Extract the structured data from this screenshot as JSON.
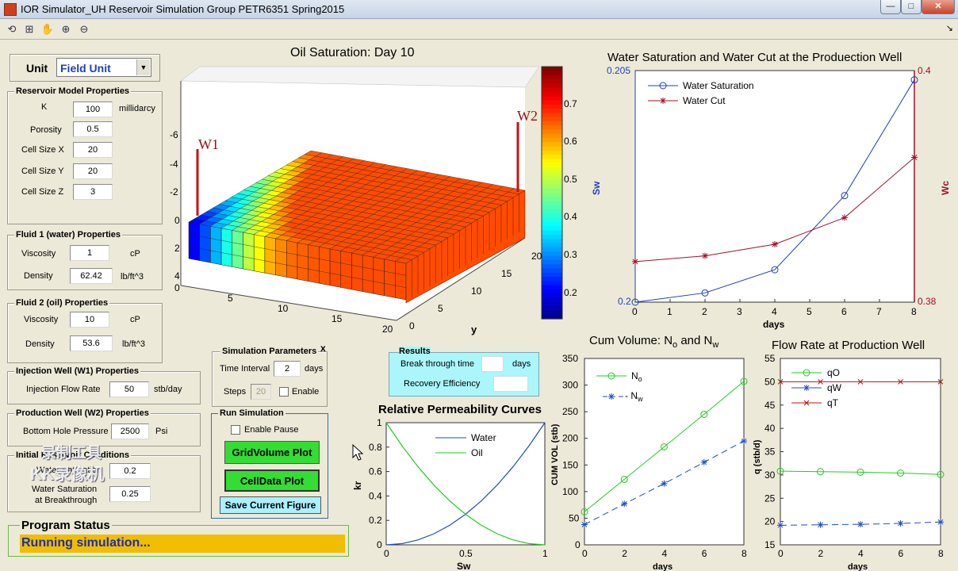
{
  "window": {
    "title": "IOR Simulator_UH Reservoir Simulation Group PETR6351 Spring2015",
    "btn_min": "—",
    "btn_max": "□",
    "btn_close": "✕",
    "dock": "↘"
  },
  "toolbar": {
    "icons": [
      "⟲",
      "⊞",
      "✋",
      "⊕",
      "⊖"
    ]
  },
  "unit": {
    "label": "Unit",
    "value": "Field Unit",
    "arrow": "▼"
  },
  "reservoir": {
    "title": "Reservoir Model Properties",
    "rows": [
      {
        "label": "K",
        "value": "100",
        "unit": "millidarcy"
      },
      {
        "label": "Porosity",
        "value": "0.5",
        "unit": ""
      },
      {
        "label": "Cell Size X",
        "value": "20",
        "unit": ""
      },
      {
        "label": "Cell Size Y",
        "value": "20",
        "unit": ""
      },
      {
        "label": "Cell Size Z",
        "value": "3",
        "unit": ""
      }
    ]
  },
  "fluid1": {
    "title": "Fluid 1 (water) Properties",
    "rows": [
      {
        "label": "Viscosity",
        "value": "1",
        "unit": "cP"
      },
      {
        "label": "Density",
        "value": "62.42",
        "unit": "lb/ft^3"
      }
    ]
  },
  "fluid2": {
    "title": "Fluid 2 (oil) Properties",
    "rows": [
      {
        "label": "Viscosity",
        "value": "10",
        "unit": "cP"
      },
      {
        "label": "Density",
        "value": "53.6",
        "unit": "lb/ft^3"
      }
    ]
  },
  "injection": {
    "title": "Injection Well (W1) Properties",
    "label": "Injection Flow Rate",
    "value": "50",
    "unit": "stb/day"
  },
  "production": {
    "title": "Production Well (W2) Properties",
    "label": "Bottom Hole Pressure",
    "value": "2500",
    "unit": "Psi"
  },
  "initial": {
    "title": "Initial Reservoir Conditions",
    "sat_label": "Water Saturation",
    "sat_value": "0.2",
    "brk_label1": "Water Saturation",
    "brk_label2": "at Breakthrough",
    "brk_value": "0.25"
  },
  "status": {
    "title": "Program Status",
    "message": "Running simulation..."
  },
  "simparams": {
    "title": "Simulation Parameters",
    "close": "x",
    "interval_label": "Time Interval",
    "interval_value": "2",
    "interval_unit": "days",
    "steps_label": "Steps",
    "steps_value": "20",
    "enable_label": "Enable"
  },
  "runsim": {
    "title": "Run Simulation",
    "pause_label": "Enable Pause",
    "grid_btn": "GridVolume Plot",
    "cell_btn": "CellData Plot",
    "save_btn": "Save Current Figure"
  },
  "results": {
    "title": "Results",
    "breakthrough_label": "Break through time",
    "breakthrough_value": "",
    "breakthrough_unit": "days",
    "recovery_label": "Recovery Efficiency",
    "recovery_value": ""
  },
  "watermark": {
    "line1": "录制工具",
    "line2": "KK录像机"
  },
  "plot3d": {
    "title": "Oil Saturation: Day 10",
    "well1": "W1",
    "well2": "W2",
    "z_ticks": [
      "-6",
      "-4",
      "-2",
      "0",
      "2",
      "4"
    ],
    "x_ticks": [
      "0",
      "5",
      "10",
      "15",
      "20"
    ],
    "y_ticks": [
      "0",
      "5",
      "10",
      "15",
      "20"
    ],
    "y_label": "y",
    "colorbar_ticks": [
      "0.7",
      "0.6",
      "0.5",
      "0.4",
      "0.3",
      "0.2"
    ],
    "front_sat": [
      0.12,
      0.2,
      0.3,
      0.4,
      0.48,
      0.56,
      0.62,
      0.7,
      0.74,
      0.77,
      0.78,
      0.79,
      0.79,
      0.8,
      0.8,
      0.8,
      0.8,
      0.8,
      0.8,
      0.8
    ]
  },
  "colors": {
    "water_sat": "#1f3fbf",
    "water_cut": "#a0102a",
    "oil_green": "#22cc22",
    "water_blue": "#1f4fbf",
    "qt_red": "#c01010",
    "status_bar": "#f0bd00",
    "status_text": "#1b2fb0"
  },
  "chart_data": [
    {
      "type": "line",
      "title": "Water Saturation and Water Cut at the Produection Well",
      "xlabel": "days",
      "ylabel": "Sw",
      "y2label": "Wc",
      "x": [
        0,
        2,
        4,
        6,
        8
      ],
      "xlim": [
        0,
        8
      ],
      "ylim": [
        0.2,
        0.205
      ],
      "y2lim": [
        0.38,
        0.4
      ],
      "yticks": [
        "0.205",
        "0.2"
      ],
      "y2ticks": [
        "0.4",
        "0.38"
      ],
      "xticks": [
        "0",
        "1",
        "2",
        "3",
        "4",
        "5",
        "6",
        "7",
        "8"
      ],
      "legend": "top-left",
      "series": [
        {
          "name": "Water Saturation",
          "axis": "left",
          "values": [
            0.2,
            0.2002,
            0.2007,
            0.2023,
            0.2048
          ]
        },
        {
          "name": "Water Cut",
          "axis": "right",
          "values": [
            0.3835,
            0.384,
            0.385,
            0.3873,
            0.3925
          ]
        }
      ]
    },
    {
      "type": "line",
      "title": "Relative Permeability Curves",
      "xlabel": "Sw",
      "ylabel": "kr",
      "xlim": [
        0,
        1
      ],
      "ylim": [
        0,
        1
      ],
      "xticks": [
        "0",
        "0.5",
        "1"
      ],
      "yticks": [
        "0",
        "0.2",
        "0.4",
        "0.6",
        "0.8",
        "1"
      ],
      "legend": "top-right",
      "x": [
        0,
        0.1,
        0.2,
        0.3,
        0.4,
        0.5,
        0.6,
        0.7,
        0.8,
        0.9,
        1
      ],
      "series": [
        {
          "name": "Water",
          "values": [
            0,
            0.01,
            0.04,
            0.09,
            0.16,
            0.25,
            0.36,
            0.49,
            0.64,
            0.81,
            1
          ]
        },
        {
          "name": "Oil",
          "values": [
            1,
            0.81,
            0.64,
            0.49,
            0.36,
            0.25,
            0.16,
            0.09,
            0.04,
            0.01,
            0
          ]
        }
      ]
    },
    {
      "type": "line",
      "title_main": "Cum Volume: N",
      "title_sub1": "o",
      "title_mid": " and N",
      "title_sub2": "w",
      "xlabel": "days",
      "ylabel": "CUM VOL (stb)",
      "xlim": [
        0,
        8
      ],
      "ylim": [
        0,
        350
      ],
      "xticks": [
        "0",
        "2",
        "4",
        "6",
        "8"
      ],
      "yticks": [
        "0",
        "50",
        "100",
        "150",
        "200",
        "250",
        "300",
        "350"
      ],
      "legend": "top-left",
      "legend_sub": [
        "o",
        "w"
      ],
      "x": [
        0,
        2,
        4,
        6,
        8
      ],
      "series": [
        {
          "name": "N",
          "values": [
            62,
            123,
            184,
            245,
            307
          ]
        },
        {
          "name": "- N",
          "values": [
            38,
            77,
            115,
            155,
            195
          ]
        }
      ]
    },
    {
      "type": "line",
      "title": "Flow Rate at Production Well",
      "xlabel": "days",
      "ylabel": "q (stb/d)",
      "xlim": [
        0,
        8
      ],
      "ylim": [
        15,
        55
      ],
      "xticks": [
        "0",
        "2",
        "4",
        "6",
        "8"
      ],
      "yticks": [
        "15",
        "20",
        "25",
        "30",
        "35",
        "40",
        "45",
        "50",
        "55"
      ],
      "legend": "top-left",
      "x": [
        0,
        2,
        4,
        6,
        8
      ],
      "series": [
        {
          "name": "qO",
          "values": [
            30.8,
            30.7,
            30.6,
            30.4,
            30.1
          ]
        },
        {
          "name": "qW",
          "values": [
            19.2,
            19.3,
            19.4,
            19.6,
            19.9
          ]
        },
        {
          "name": "qT",
          "values": [
            50,
            50,
            50,
            50,
            50
          ]
        }
      ]
    }
  ]
}
